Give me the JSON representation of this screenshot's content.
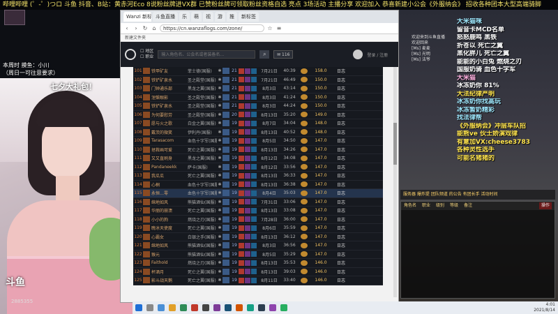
{
  "ticker": "哔哩哔哩 (゜-゜)つロ 斗鱼 抖音、B站：黄赤河Eco 8说粉丝牌进VX群 已赞粉丝牌可领取粉丝资格自选 亮点 3场活动 主播分享 欢迎加入 恭喜新建小公会《外服纳会》 招收各种团本大型高端骑脚",
  "stream": {
    "cam_label": "七夕大礼包！",
    "caption_line1": "本周时 摸鱼：小川",
    "caption_line2": "（周日一可往意要求）",
    "logo": "斗鱼",
    "room_id": "2885355"
  },
  "browser": {
    "tabs": [
      "Wanzi 新标",
      "斗鱼直播",
      "乐",
      "萌",
      "视",
      "游",
      "推",
      "新标签"
    ],
    "url": "https://cn.wanzaflogs.com/zone/",
    "bookmark": "新建文件夹"
  },
  "site": {
    "filters": [
      "地区",
      "职业"
    ],
    "search_placeholder": "输入角色名、公会名或者装备名…",
    "messages_btn": "116",
    "user_text": "登录 / 注册"
  },
  "table_rows": [
    {
      "rank": "101",
      "name": "铁甲矿友",
      "server": "菲士德(国服)",
      "level": "21",
      "date": "7月21日",
      "time": "40:39",
      "score": "158.0",
      "log": "日志"
    },
    {
      "rank": "102",
      "name": "铁铲矿泉水",
      "server": "圣之殿堂(国服)",
      "level": "21",
      "date": "7月21日",
      "time": "46:49",
      "score": "150.0",
      "log": "日志"
    },
    {
      "rank": "103",
      "name": "门钟通乐部",
      "server": "黑龙之翼(国服)",
      "level": "21",
      "date": "8月3日",
      "time": "43:14",
      "score": "150.0",
      "log": "日志"
    },
    {
      "rank": "104",
      "name": "涅槃眼影",
      "server": "圣之殿堂(国服)",
      "level": "21",
      "date": "8月3日",
      "time": "41:24",
      "score": "150.0",
      "log": "日志"
    },
    {
      "rank": "105",
      "name": "铁铲矿泉水",
      "server": "圣之殿堂(国服)",
      "level": "21",
      "date": "8月3日",
      "time": "44:24",
      "score": "150.0",
      "log": "日志"
    },
    {
      "rank": "106",
      "name": "为何要慰劳",
      "server": "圣之殿堂(国服)",
      "level": "20",
      "date": "8月13日",
      "time": "35:20",
      "score": "149.0",
      "log": "日志"
    },
    {
      "rank": "107",
      "name": "愿与火之歌",
      "server": "白金之翼(国服)",
      "level": "19",
      "date": "8月7日",
      "time": "34:04",
      "score": "148.0",
      "log": "日志"
    },
    {
      "rank": "108",
      "name": "戴茨的微笑",
      "server": "伊利丹(国服)",
      "level": "19",
      "date": "8月13日",
      "time": "40:52",
      "score": "148.0",
      "log": "日志"
    },
    {
      "rank": "109",
      "name": "Tarasacom",
      "server": "血色十字军(国服)",
      "level": "19",
      "date": "8月5日",
      "time": "34:50",
      "score": "147.0",
      "log": "日志"
    },
    {
      "rank": "110",
      "name": "拯救画可爱",
      "server": "死亡之翼(国服)",
      "level": "19",
      "date": "8月13日",
      "time": "34:26",
      "score": "147.0",
      "log": "日志"
    },
    {
      "rank": "111",
      "name": "又又直刷身",
      "server": "黑龙之翼(国服)",
      "level": "19",
      "date": "8月12日",
      "time": "34:08",
      "score": "147.0",
      "log": "日志"
    },
    {
      "rank": "112",
      "name": "Pandaneekk",
      "server": "萨卡(国服)",
      "level": "19",
      "date": "8月12日",
      "time": "33:56",
      "score": "147.0",
      "log": "日志"
    },
    {
      "rank": "113",
      "name": "我瓜瓜",
      "server": "死亡之翼(国服)",
      "level": "19",
      "date": "8月13日",
      "time": "36:33",
      "score": "147.0",
      "log": "日志"
    },
    {
      "rank": "114",
      "name": "心桐",
      "server": "血色十字军(国服)",
      "level": "19",
      "date": "8月13日",
      "time": "36:38",
      "score": "147.0",
      "log": "日志"
    },
    {
      "rank": "115",
      "name": "永恒…零",
      "server": "血色十字军(国服)",
      "level": "19",
      "date": "8月4日",
      "time": "35:03",
      "score": "147.0",
      "log": "日志",
      "highlight": true
    },
    {
      "rank": "116",
      "name": "绵地如风",
      "server": "熊猫酒仙(国服)",
      "level": "19",
      "date": "7月31日",
      "time": "33:06",
      "score": "147.0",
      "log": "日志"
    },
    {
      "rank": "117",
      "name": "华丽的崩溃",
      "server": "死亡之翼(国服)",
      "level": "19",
      "date": "8月13日",
      "time": "33:08",
      "score": "147.0",
      "log": "日志"
    },
    {
      "rank": "118",
      "name": "小小的狗",
      "server": "燃烧之刃(国服)",
      "level": "19",
      "date": "7月28日",
      "time": "36:00",
      "score": "147.0",
      "log": "日志"
    },
    {
      "rank": "119",
      "name": "晚冰天使度",
      "server": "死亡之翼(国服)",
      "level": "19",
      "date": "8月6日",
      "time": "35:59",
      "score": "147.0",
      "log": "日志"
    },
    {
      "rank": "120",
      "name": "心霸女",
      "server": "白银之手(国服)",
      "level": "19",
      "date": "8月13日",
      "time": "36:12",
      "score": "147.0",
      "log": "日志"
    },
    {
      "rank": "121",
      "name": "绵地如风",
      "server": "熊猫酒仙(国服)",
      "level": "19",
      "date": "8月3日",
      "time": "36:56",
      "score": "147.0",
      "log": "日志"
    },
    {
      "rank": "122",
      "name": "猴元",
      "server": "熊猫酒仙(国服)",
      "level": "19",
      "date": "8月5日",
      "time": "35:29",
      "score": "147.0",
      "log": "日志"
    },
    {
      "rank": "123",
      "name": "Faithold",
      "server": "燃烧之刃(国服)",
      "level": "19",
      "date": "8月13日",
      "time": "35:53",
      "score": "146.0",
      "log": "日志"
    },
    {
      "rank": "124",
      "name": "杯酒月",
      "server": "死亡之翼(国服)",
      "level": "19",
      "date": "8月13日",
      "time": "39:03",
      "score": "146.0",
      "log": "日志"
    },
    {
      "rank": "125",
      "name": "影斗战天鹅",
      "server": "死亡之翼(国服)",
      "level": "19",
      "date": "8月11日",
      "time": "33:40",
      "score": "146.0",
      "log": "日志"
    }
  ],
  "chat_overlay": [
    {
      "text": "大米猫咪",
      "color": "cyan"
    },
    {
      "text": "留音卡MCD名单",
      "color": "white"
    },
    {
      "text": "怒怒鹿鸣 黑铁",
      "color": "white"
    },
    {
      "text": "折苍以 死亡之翼",
      "color": "white"
    },
    {
      "text": "黑化胖儿 死亡之翼",
      "color": "white"
    },
    {
      "text": "能能的小白兔 燃烧之刃",
      "color": "white"
    },
    {
      "text": "国服奶骑 血色十字军",
      "color": "white"
    },
    {
      "text": "大米猫",
      "color": "pink"
    },
    {
      "text": "",
      "color": "white"
    },
    {
      "text": "冰冻奶你 81%",
      "color": "white"
    },
    {
      "text": "",
      "color": "white"
    },
    {
      "text": "大法纪律严明",
      "color": "yellow"
    },
    {
      "text": "冰冻奶你找高玩",
      "color": "cyan"
    },
    {
      "text": "冰冻暂奶精彩",
      "color": "cyan"
    },
    {
      "text": "找法律帮",
      "color": "cyan"
    },
    {
      "text": "《外服纳会》冲层车队招",
      "color": "yellow"
    },
    {
      "text": "能熊ve 伙士娇演戏律",
      "color": "yellow"
    },
    {
      "text": "有意加VX:cheese3783",
      "color": "yellow"
    },
    {
      "text": "各种灵性选手",
      "color": "yellow"
    },
    {
      "text": "可能名猪猪的",
      "color": "yellow"
    }
  ],
  "side_chat": [
    "欢迎来到斗鱼直播",
    "欢迎回来",
    "[Ms] 麦麦",
    "[Ms] 光明",
    "[Ms] 法爷"
  ],
  "guild": {
    "notice": "服务器 爆炸提 团队频道 的公告 有团长手 活动时间",
    "columns": [
      "角色名",
      "职业",
      "级别",
      "等级",
      "备注"
    ],
    "button": "操作"
  },
  "clock": {
    "time": "4:01",
    "date": "2021/8/14"
  }
}
